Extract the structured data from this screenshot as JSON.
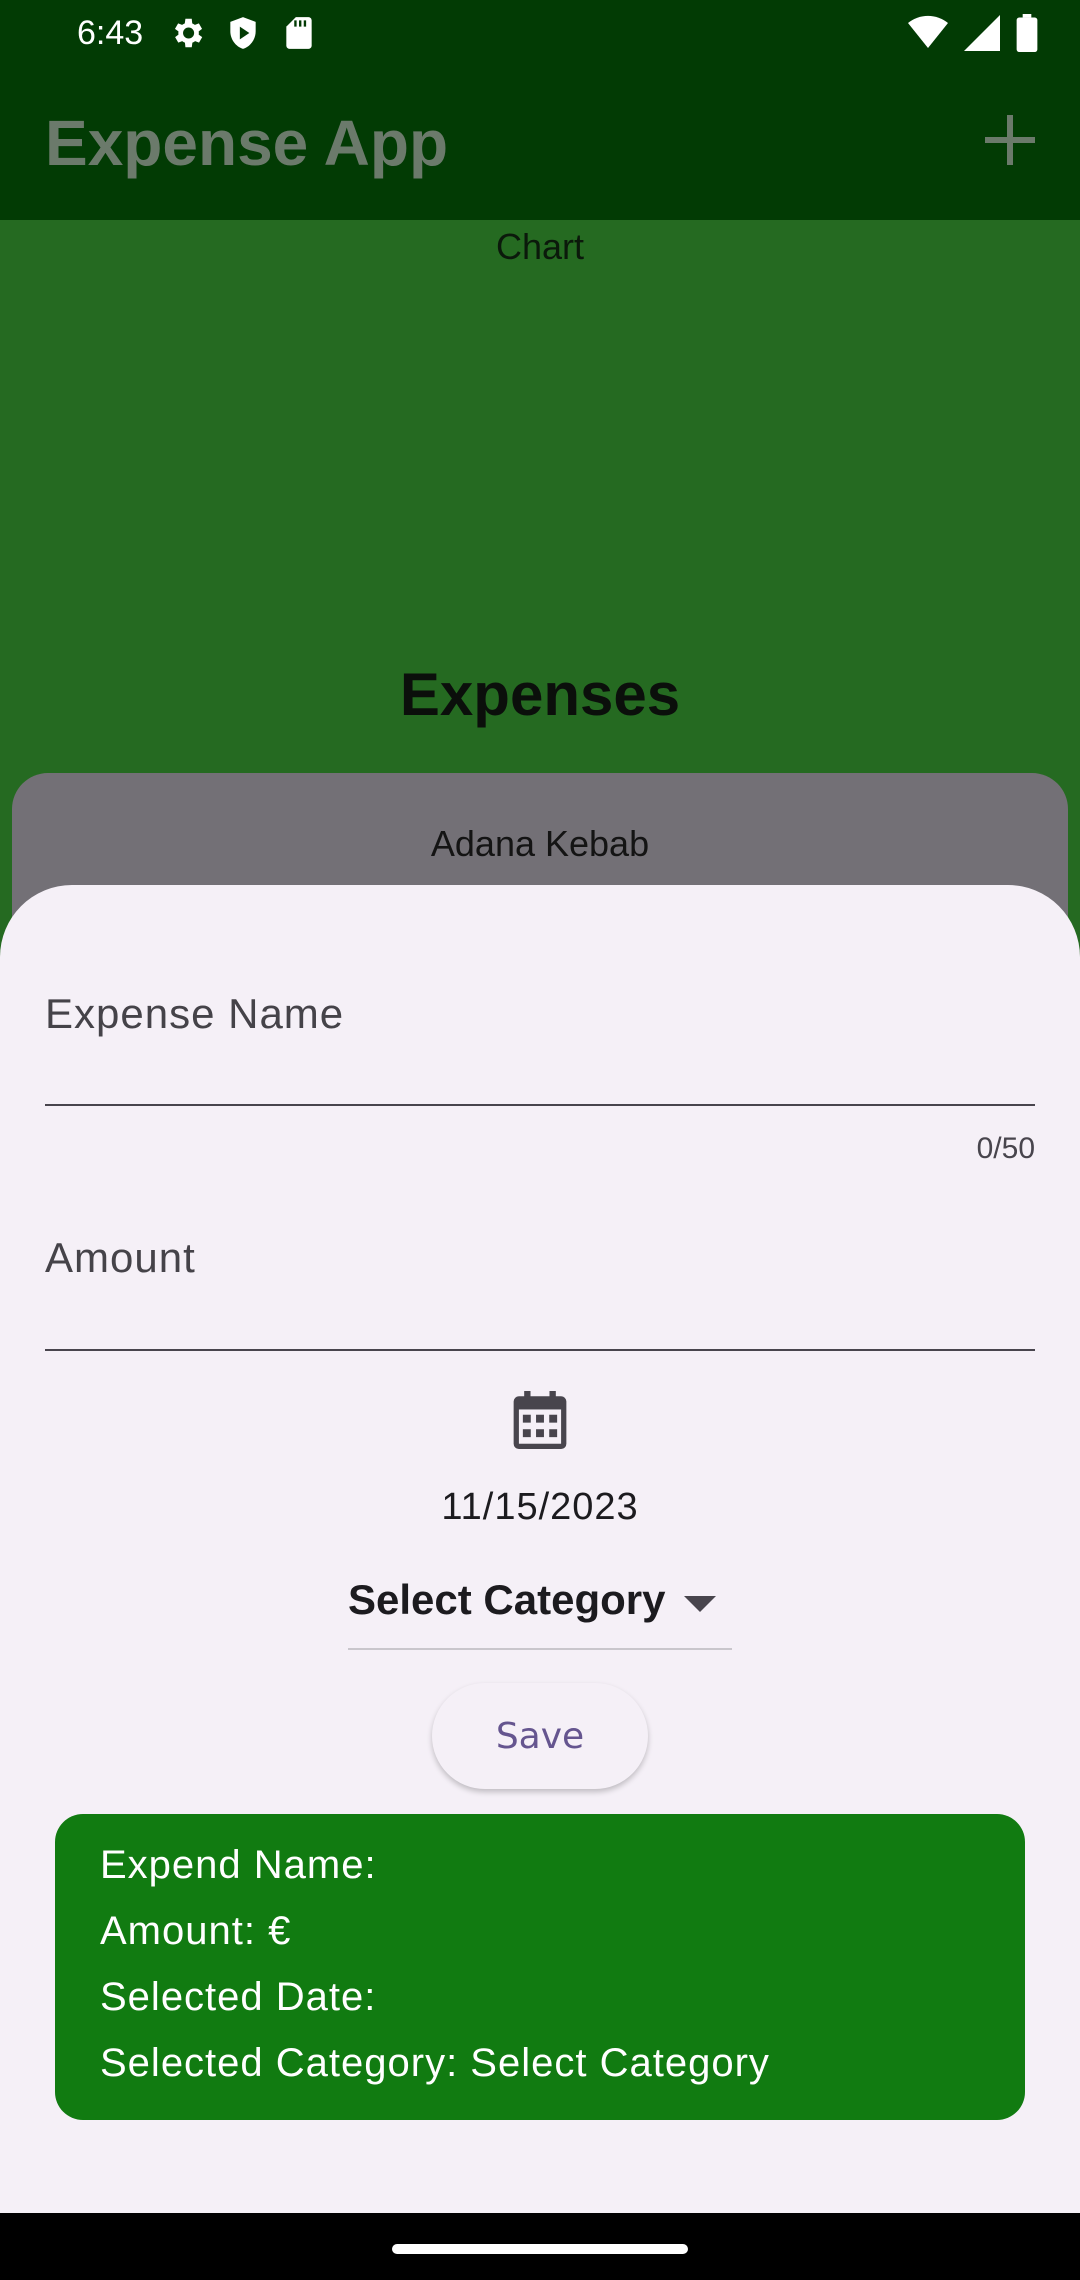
{
  "status_bar": {
    "time": "6:43",
    "icons_left": [
      "gear-icon",
      "shield-play-icon",
      "sd-card-icon"
    ],
    "icons_right": [
      "wifi-icon",
      "signal-icon",
      "battery-icon"
    ]
  },
  "app_bar": {
    "title": "Expense App",
    "action_icon": "plus-icon"
  },
  "background": {
    "chart_label": "Chart",
    "expenses_heading": "Expenses",
    "expense_item_name": "Adana Kebab"
  },
  "sheet": {
    "expense_name": {
      "label": "Expense Name",
      "value": "",
      "counter": "0/50"
    },
    "amount": {
      "label": "Amount",
      "value": ""
    },
    "date_picker_icon": "calendar-icon",
    "date_value": "11/15/2023",
    "category": {
      "selected": "Select Category"
    },
    "save_label": "Save",
    "summary": {
      "expend_name": "Expend Name: ",
      "amount": "Amount:  €",
      "selected_date": "Selected Date: ",
      "selected_category": "Selected Category: Select Category"
    }
  },
  "colors": {
    "app_bar": "#023b04",
    "content_green": "#256a21",
    "sheet_bg": "#f5f0f7",
    "summary_green": "#117b11",
    "save_text": "#65558f"
  }
}
